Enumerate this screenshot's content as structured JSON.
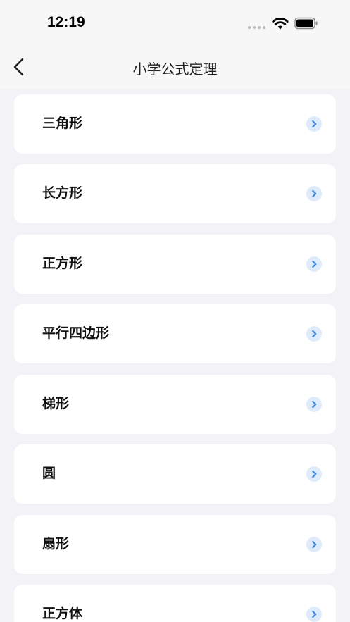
{
  "status": {
    "time": "12:19"
  },
  "nav": {
    "title": "小学公式定理",
    "back_icon": "chevron-left-icon"
  },
  "items": [
    {
      "label": "三角形"
    },
    {
      "label": "长方形"
    },
    {
      "label": "正方形"
    },
    {
      "label": "平行四边形"
    },
    {
      "label": "梯形"
    },
    {
      "label": "圆"
    },
    {
      "label": "扇形"
    },
    {
      "label": "正方体"
    }
  ],
  "colors": {
    "background": "#f2f2f7",
    "card": "#ffffff",
    "chevron_bg": "#deebfb",
    "chevron": "#3d86e0"
  }
}
